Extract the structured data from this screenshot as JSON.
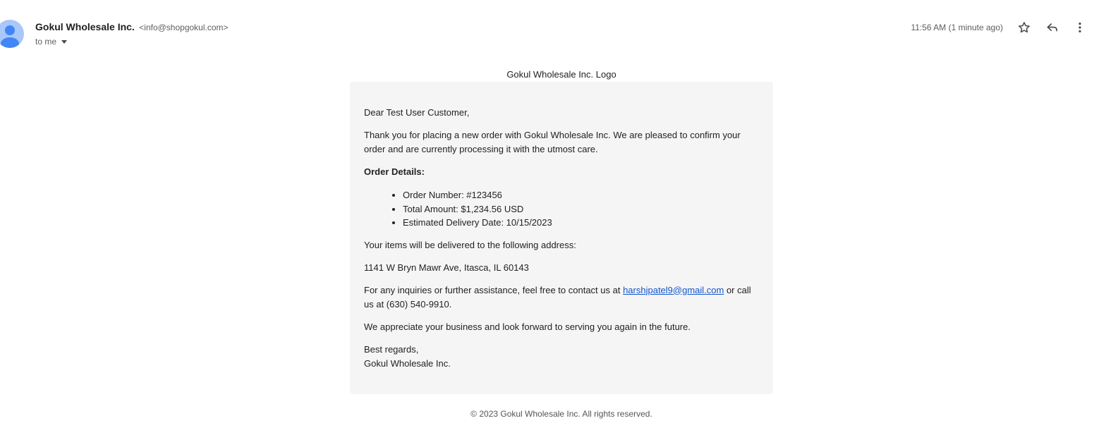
{
  "header": {
    "sender_name": "Gokul Wholesale Inc.",
    "sender_email": "<info@shopgokul.com>",
    "recipient_label": "to me",
    "timestamp": "11:56 AM (1 minute ago)",
    "icons": [
      "avatar-icon",
      "star-icon",
      "reply-icon",
      "more-vert-icon"
    ]
  },
  "email": {
    "logo_alt": "Gokul Wholesale Inc. Logo",
    "greeting": "Dear Test User Customer,",
    "intro": "Thank you for placing a new order with Gokul Wholesale Inc. We are pleased to confirm your order and are currently processing it with the utmost care.",
    "details_heading": "Order Details:",
    "details": [
      "Order Number: #123456",
      "Total Amount: $1,234.56 USD",
      "Estimated Delivery Date: 10/15/2023"
    ],
    "delivery_intro": "Your items will be delivered to the following address:",
    "address": "1141 W Bryn Mawr Ave, Itasca, IL 60143",
    "contact_prefix": "For any inquiries or further assistance, feel free to contact us at ",
    "contact_email": "harshjpatel9@gmail.com",
    "contact_suffix": " or call us at (630) 540-9910.",
    "appreciation": "We appreciate your business and look forward to serving you again in the future.",
    "closing": "Best regards,",
    "signature": "Gokul Wholesale Inc."
  },
  "footer": {
    "copyright": "© 2023 Gokul Wholesale Inc. All rights reserved."
  },
  "colors": {
    "link": "#1155cc",
    "card_background": "#f5f5f5",
    "avatar_background": "#a8c7fa",
    "avatar_figure": "#4285f4"
  }
}
